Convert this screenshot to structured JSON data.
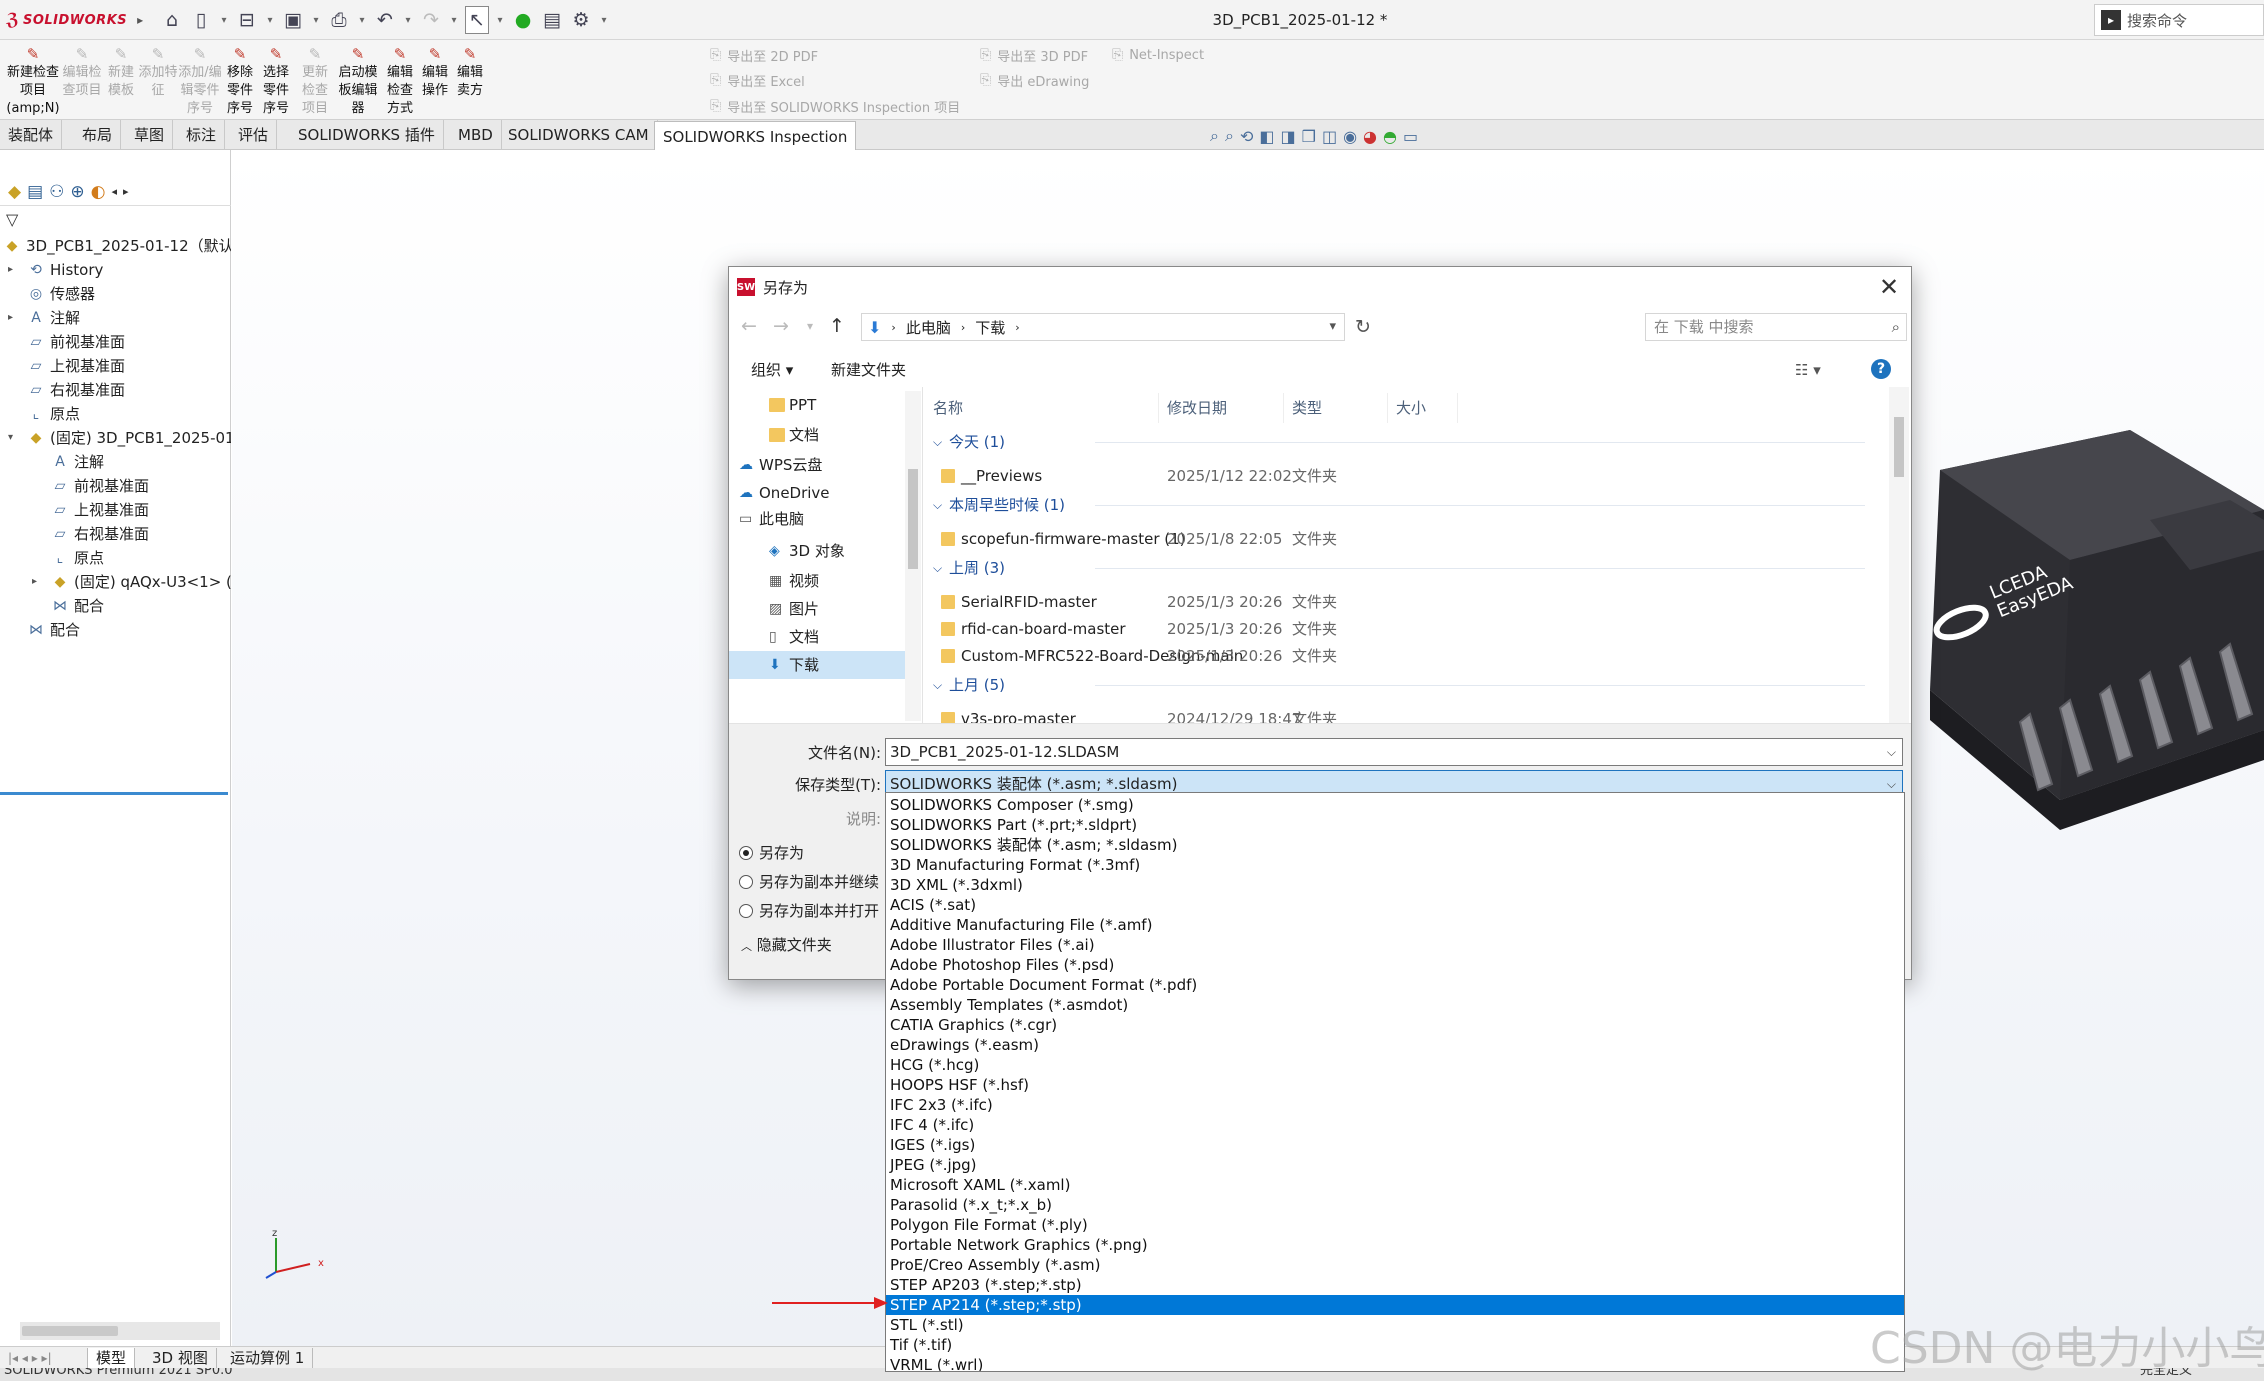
{
  "app": {
    "brand": "SOLIDWORKS",
    "document_title": "3D_PCB1_2025-01-12 *",
    "search_placeholder": "搜索命令"
  },
  "ribbon": {
    "buttons": [
      {
        "label": "新建检查项目(amp;N)",
        "enabled": true,
        "icon": "new-inspection-icon"
      },
      {
        "label": "编辑检查项目",
        "enabled": false,
        "icon": "edit-inspection-icon"
      },
      {
        "label": "新建模板",
        "enabled": false,
        "icon": "new-template-icon"
      },
      {
        "label": "添加特征",
        "enabled": false,
        "icon": "add-feature-icon"
      },
      {
        "label": "添加/编辑零件序号",
        "enabled": false,
        "icon": "balloon-icon"
      },
      {
        "label": "移除零件序号",
        "enabled": true,
        "icon": "remove-balloon-icon"
      },
      {
        "label": "选择零件序号",
        "enabled": true,
        "icon": "select-balloon-icon"
      },
      {
        "label": "更新检查项目",
        "enabled": false,
        "icon": "update-icon"
      },
      {
        "label": "启动模板编辑器",
        "enabled": true,
        "icon": "template-editor-icon"
      },
      {
        "label": "编辑检查方式",
        "enabled": true,
        "icon": "edit-method-icon"
      },
      {
        "label": "编辑操作",
        "enabled": true,
        "icon": "edit-operation-icon"
      },
      {
        "label": "编辑卖方",
        "enabled": true,
        "icon": "edit-vendor-icon"
      }
    ],
    "exports": [
      "导出至 2D PDF",
      "导出至 Excel",
      "导出至 SOLIDWORKS Inspection 项目",
      "导出至 3D PDF",
      "导出 eDrawing",
      "Net-Inspect"
    ]
  },
  "tabs": [
    "装配体",
    "布局",
    "草图",
    "标注",
    "评估",
    "SOLIDWORKS 插件",
    "MBD",
    "SOLIDWORKS CAM",
    "SOLIDWORKS Inspection"
  ],
  "active_tab": "SOLIDWORKS Inspection",
  "tree": {
    "root": "3D_PCB1_2025-01-12（默认...",
    "items": [
      {
        "label": "History",
        "indent": 0,
        "expander": "▸",
        "icon": "history-icon"
      },
      {
        "label": "传感器",
        "indent": 0,
        "expander": "",
        "icon": "sensor-icon"
      },
      {
        "label": "注解",
        "indent": 0,
        "expander": "▸",
        "icon": "annotation-icon"
      },
      {
        "label": "前视基准面",
        "indent": 0,
        "expander": "",
        "icon": "plane-icon"
      },
      {
        "label": "上视基准面",
        "indent": 0,
        "expander": "",
        "icon": "plane-icon"
      },
      {
        "label": "右视基准面",
        "indent": 0,
        "expander": "",
        "icon": "plane-icon"
      },
      {
        "label": "原点",
        "indent": 0,
        "expander": "",
        "icon": "origin-icon"
      },
      {
        "label": "(固定) 3D_PCB1_2025-01-...",
        "indent": 0,
        "expander": "▾",
        "icon": "part-icon"
      },
      {
        "label": "注解",
        "indent": 1,
        "expander": "",
        "icon": "annotation-icon"
      },
      {
        "label": "前视基准面",
        "indent": 1,
        "expander": "",
        "icon": "plane-icon"
      },
      {
        "label": "上视基准面",
        "indent": 1,
        "expander": "",
        "icon": "plane-icon"
      },
      {
        "label": "右视基准面",
        "indent": 1,
        "expander": "",
        "icon": "plane-icon"
      },
      {
        "label": "原点",
        "indent": 1,
        "expander": "",
        "icon": "origin-icon"
      },
      {
        "label": "(固定) qAQx-U3<1> (...",
        "indent": 1,
        "expander": "▸",
        "icon": "part-icon"
      },
      {
        "label": "配合",
        "indent": 1,
        "expander": "",
        "icon": "mate-icon"
      },
      {
        "label": "配合",
        "indent": 0,
        "expander": "",
        "icon": "mate-icon"
      }
    ]
  },
  "bottom_tabs": [
    "模型",
    "3D 视图",
    "运动算例 1"
  ],
  "status_text": "SOLIDWORKS Premium 2021 SP0.0",
  "status_right": "完全定义",
  "dialog": {
    "title": "另存为",
    "breadcrumb": [
      "此电脑",
      "下载"
    ],
    "search_placeholder": "在 下载 中搜索",
    "organize": "组织 ▾",
    "new_folder": "新建文件夹",
    "nav_items": [
      {
        "label": "PPT",
        "indent": 2,
        "icon": "folder-icon"
      },
      {
        "label": "文档",
        "indent": 2,
        "icon": "folder-icon"
      },
      {
        "label": "WPS云盘",
        "indent": 1,
        "icon": "cloud-icon"
      },
      {
        "label": "OneDrive",
        "indent": 1,
        "icon": "cloud-icon"
      },
      {
        "label": "此电脑",
        "indent": 1,
        "icon": "computer-icon"
      },
      {
        "label": "3D 对象",
        "indent": 2,
        "icon": "3d-objects-icon"
      },
      {
        "label": "视频",
        "indent": 2,
        "icon": "video-icon"
      },
      {
        "label": "图片",
        "indent": 2,
        "icon": "pictures-icon"
      },
      {
        "label": "文档",
        "indent": 2,
        "icon": "documents-icon"
      },
      {
        "label": "下载",
        "indent": 2,
        "icon": "download-icon",
        "selected": true
      }
    ],
    "columns": [
      "名称",
      "修改日期",
      "类型",
      "大小"
    ],
    "groups": [
      {
        "label": "今天 (1)",
        "files": [
          {
            "name": "__Previews",
            "date": "2025/1/12 22:02",
            "type": "文件夹"
          }
        ]
      },
      {
        "label": "本周早些时候 (1)",
        "files": [
          {
            "name": "scopefun-firmware-master (1)",
            "date": "2025/1/8 22:05",
            "type": "文件夹"
          }
        ]
      },
      {
        "label": "上周 (3)",
        "files": [
          {
            "name": "SerialRFID-master",
            "date": "2025/1/3 20:26",
            "type": "文件夹"
          },
          {
            "name": "rfid-can-board-master",
            "date": "2025/1/3 20:26",
            "type": "文件夹"
          },
          {
            "name": "Custom-MFRC522-Board-Design-main",
            "date": "2025/1/3 20:26",
            "type": "文件夹"
          }
        ]
      },
      {
        "label": "上月 (5)",
        "files": [
          {
            "name": "v3s-pro-master",
            "date": "2024/12/29 18:47",
            "type": "文件夹"
          }
        ]
      }
    ],
    "filename_label": "文件名(N):",
    "filename_value": "3D_PCB1_2025-01-12.SLDASM",
    "filetype_label": "保存类型(T):",
    "filetype_value": "SOLIDWORKS 装配体 (*.asm; *.sldasm)",
    "description_label": "说明:",
    "radios": [
      {
        "label": "另存为",
        "checked": true
      },
      {
        "label": "另存为副本并继续",
        "checked": false
      },
      {
        "label": "另存为副本并打开",
        "checked": false
      }
    ],
    "hide_folders": "隐藏文件夹"
  },
  "filetype_options": [
    "SOLIDWORKS Composer (*.smg)",
    "SOLIDWORKS Part (*.prt;*.sldprt)",
    "SOLIDWORKS 装配体 (*.asm; *.sldasm)",
    "3D Manufacturing Format (*.3mf)",
    "3D XML (*.3dxml)",
    "ACIS (*.sat)",
    "Additive Manufacturing File (*.amf)",
    "Adobe Illustrator Files (*.ai)",
    "Adobe Photoshop Files  (*.psd)",
    "Adobe Portable Document Format (*.pdf)",
    "Assembly Templates (*.asmdot)",
    "CATIA Graphics (*.cgr)",
    "eDrawings (*.easm)",
    "HCG (*.hcg)",
    "HOOPS HSF (*.hsf)",
    "IFC 2x3 (*.ifc)",
    "IFC 4 (*.ifc)",
    "IGES (*.igs)",
    "JPEG (*.jpg)",
    "Microsoft XAML (*.xaml)",
    "Parasolid (*.x_t;*.x_b)",
    "Polygon File Format (*.ply)",
    "Portable Network Graphics (*.png)",
    "ProE/Creo Assembly (*.asm)",
    "STEP AP203 (*.step;*.stp)",
    "STEP AP214 (*.step;*.stp)",
    "STL (*.stl)",
    "Tif (*.tif)",
    "VRML (*.wrl)"
  ],
  "highlighted_option": "STEP AP214 (*.step;*.stp)",
  "chip_label": [
    "LCEDA",
    "EasyEDA"
  ],
  "watermark": "CSDN @电力小小鸟",
  "colors": {
    "accent": "#0078d7",
    "brand": "#c8102e",
    "folder": "#f3c75f",
    "selection": "#cce4f7",
    "annotation_arrow": "#e02020"
  }
}
